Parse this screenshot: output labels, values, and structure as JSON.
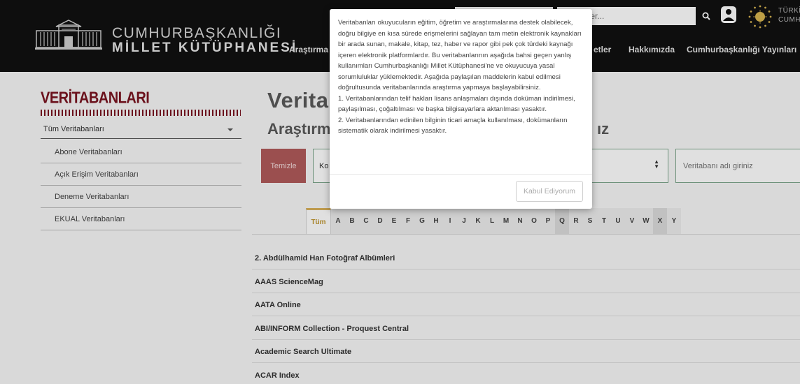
{
  "header": {
    "brand_line1": "CUMHURBAŞKANLIĞI",
    "brand_line2": "MİLLET KÜTÜPHANESİ",
    "nav": [
      {
        "label": "Araştırma"
      },
      {
        "label": "etler"
      },
      {
        "label": "Hakkımızda"
      },
      {
        "label": "Cumhurbaşkanlığı Yayınları"
      }
    ],
    "search_placeholder": "Kelimeler...",
    "gov_line1": "TÜRKİ",
    "gov_line2": "CUMH"
  },
  "sidebar": {
    "title": "VERİTABANLARI",
    "top": "Tüm Veritabanları",
    "items": [
      {
        "label": "Abone Veritabanları"
      },
      {
        "label": "Açık Erişim Veritabanları"
      },
      {
        "label": "Deneme Veritabanları"
      },
      {
        "label": "EKUAL Veritabanları"
      }
    ]
  },
  "main": {
    "title": "Verita",
    "subtitle": "Araştırma",
    "subtitle_end": "ız",
    "clear_label": "Temizle",
    "select_value": "Ko",
    "name_placeholder": "Veritabanı adı giriniz",
    "letters": [
      "Tüm",
      "A",
      "B",
      "C",
      "D",
      "E",
      "F",
      "G",
      "H",
      "I",
      "J",
      "K",
      "L",
      "M",
      "N",
      "O",
      "P",
      "Q",
      "R",
      "S",
      "T",
      "U",
      "V",
      "W",
      "X",
      "Y"
    ],
    "databases": [
      {
        "name": "2. Abdülhamid Han Fotoğraf Albümleri"
      },
      {
        "name": "AAAS ScienceMag"
      },
      {
        "name": "AATA Online"
      },
      {
        "name": "ABI/INFORM Collection - Proquest Central"
      },
      {
        "name": "Academic Search Ultimate"
      },
      {
        "name": "ACAR Index"
      }
    ]
  },
  "modal": {
    "paragraph1": "Veritabanları okuyucuların eğitim, öğretim ve araştırmalarına destek olabilecek, doğru bilgiye en kısa sürede erişmelerini sağlayan tam metin elektronik kaynakları bir arada sunan, makale, kitap, tez, haber ve rapor gibi pek çok türdeki kaynağı içeren elektronik platformlardır. Bu veritabanlarının aşağıda bahsi geçen yanlış kullanımları Cumhurbaşkanlığı Millet Kütüphanesi'ne ve okuyucuya yasal sorumluluklar yüklemektedir. Aşağıda paylaşılan maddelerin kabul edilmesi doğrultusunda veritabanlarında araştırma yapmaya başlayabilirsiniz.",
    "rule1": "1. Veritabanlarından telif hakları lisans anlaşmaları dışında doküman indirilmesi, paylaşılması, çoğaltılması ve başka bilgisayarlara aktarılması yasaktır.",
    "rule2": "2. Veritabanlarından edinilen bilginin ticari amaçla kullanılması, dokümanların sistematik olarak indirilmesi yasaktır.",
    "accept_label": "Kabul Ediyorum"
  },
  "colors": {
    "header_bg": "#111111",
    "accent_maroon": "#7a1420",
    "clear_button": "#b15a5a",
    "active_letter": "#c0962f"
  }
}
